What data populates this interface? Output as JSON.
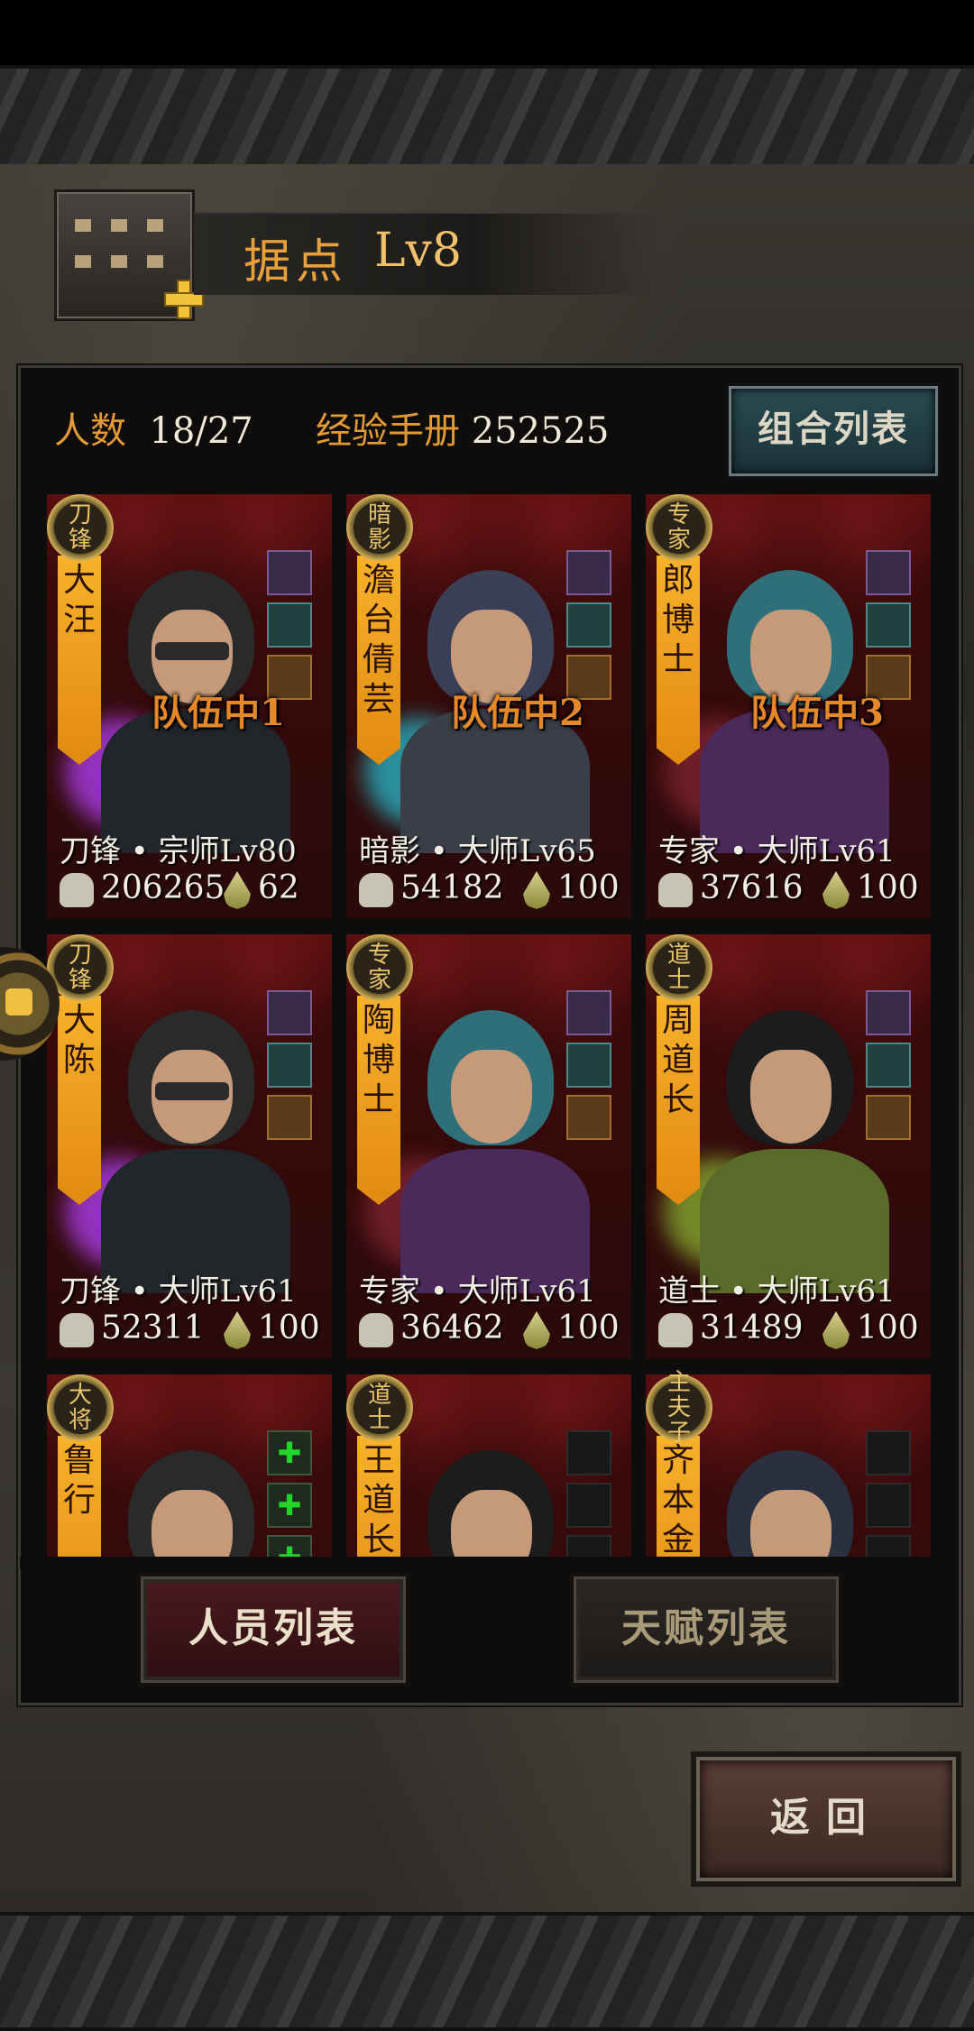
{
  "header": {
    "base_name": "据点",
    "base_level": "Lv8"
  },
  "stats": {
    "members_label": "人数",
    "members_value": "18/27",
    "exp_label": "经验手册",
    "exp_value": "252525"
  },
  "buttons": {
    "combo_list": "组合列表",
    "personnel_list": "人员列表",
    "talent_list": "天赋列表",
    "back": "返回"
  },
  "colors": {
    "accent_orange": "#e29a37",
    "banner_yellow": "#f7b12a",
    "card_red": "#5a0e10",
    "plus_green": "#23d52a"
  },
  "cards": [
    {
      "role": "刀锋",
      "name": "大汪",
      "team": "队伍中1",
      "rank": "刀锋 • 宗师Lv80",
      "power": "206265",
      "stamina": "62",
      "equips": [
        "gem",
        "ring",
        "spiral"
      ]
    },
    {
      "role": "暗影",
      "name": "澹台倩芸",
      "team": "队伍中2",
      "rank": "暗影 • 大师Lv65",
      "power": "54182",
      "stamina": "100",
      "equips": [
        "gem",
        "ring",
        "spiral"
      ]
    },
    {
      "role": "专家",
      "name": "郎博士",
      "team": "队伍中3",
      "rank": "专家 • 大师Lv61",
      "power": "37616",
      "stamina": "100",
      "equips": [
        "gem",
        "ring",
        "spiral"
      ]
    },
    {
      "role": "刀锋",
      "name": "大陈",
      "team": "",
      "rank": "刀锋 • 大师Lv61",
      "power": "52311",
      "stamina": "100",
      "equips": [
        "gem",
        "ring",
        "spiral"
      ]
    },
    {
      "role": "专家",
      "name": "陶博士",
      "team": "",
      "rank": "专家 • 大师Lv61",
      "power": "36462",
      "stamina": "100",
      "equips": [
        "gem",
        "ring",
        "spiral"
      ]
    },
    {
      "role": "道士",
      "name": "周道长",
      "team": "",
      "rank": "道士 • 大师Lv61",
      "power": "31489",
      "stamina": "100",
      "equips": [
        "gem",
        "ring",
        "spiral"
      ]
    },
    {
      "role": "大将",
      "name": "鲁行",
      "team": "",
      "rank": "",
      "power": "",
      "stamina": "",
      "equips": [
        "plus",
        "plus",
        "plus"
      ]
    },
    {
      "role": "道士",
      "name": "王道长",
      "team": "",
      "rank": "",
      "power": "",
      "stamina": "",
      "equips": [
        "empty",
        "empty",
        "empty"
      ]
    },
    {
      "role": "主夫子",
      "name": "齐本金",
      "team": "",
      "rank": "",
      "power": "",
      "stamina": "",
      "equips": [
        "empty",
        "empty",
        "empty"
      ]
    }
  ]
}
